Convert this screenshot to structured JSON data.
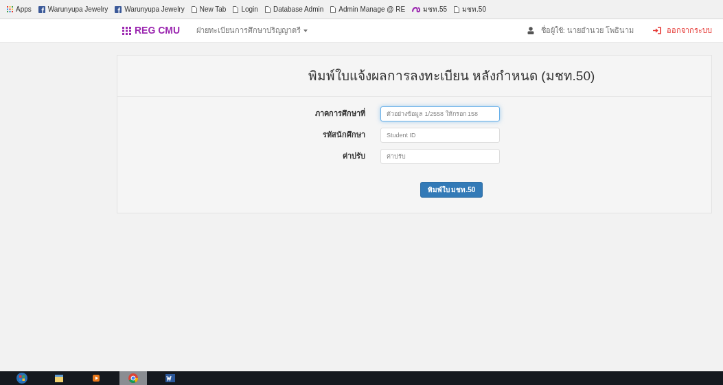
{
  "bookmarks": [
    {
      "kind": "apps",
      "label": "Apps"
    },
    {
      "kind": "facebook",
      "label": "Warunyupa Jewelry"
    },
    {
      "kind": "facebook",
      "label": "Warunyupa Jewelry"
    },
    {
      "kind": "page",
      "label": "New Tab"
    },
    {
      "kind": "page",
      "label": "Login"
    },
    {
      "kind": "page",
      "label": "Database Admin"
    },
    {
      "kind": "page",
      "label": "Admin Manage @ RE"
    },
    {
      "kind": "logo",
      "label": "มชท.55"
    },
    {
      "kind": "page",
      "label": "มชท.50"
    }
  ],
  "navbar": {
    "brand": "REG CMU",
    "menu": "ฝ่ายทะเบียนการศึกษาปริญญาตรี",
    "user": "ชื่อผู้ใช้: นายอำนวย โพธินาม",
    "logout": "ออกจากระบบ"
  },
  "form": {
    "title": "พิมพ์ใบแจ้งผลการลงทะเบียน หลังกำหนด (มชท.50)",
    "fields": [
      {
        "label": "ภาคการศึกษาที่",
        "placeholder": "ตัวอย่างข้อมูล 1/2558 ให้กรอก 158",
        "focused": true
      },
      {
        "label": "รหัสนักศึกษา",
        "placeholder": "Student ID",
        "focused": false
      },
      {
        "label": "ค่าปรับ",
        "placeholder": "ค่าปรับ",
        "focused": false
      }
    ],
    "button": "พิมพ์ใบ มชท.50"
  },
  "taskbar": [
    {
      "kind": "start",
      "selected": false
    },
    {
      "kind": "folder",
      "selected": false
    },
    {
      "kind": "media",
      "selected": false
    },
    {
      "kind": "browser",
      "selected": true
    },
    {
      "kind": "word",
      "selected": false
    }
  ]
}
